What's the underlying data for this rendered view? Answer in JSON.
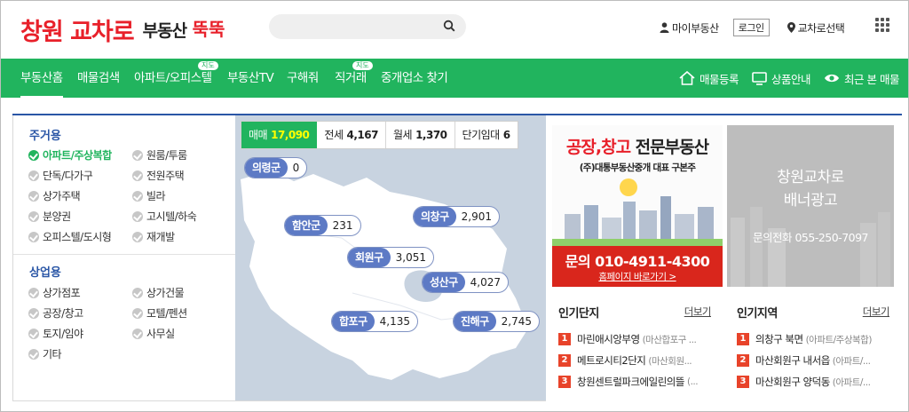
{
  "header": {
    "logo_main": "창원 교차로",
    "logo_sub": "부동산",
    "logo_ttok": "뚝뚝",
    "search_placeholder": "",
    "my_realestate": "마이부동산",
    "login": "로그인",
    "region_select": "교차로선택"
  },
  "nav": {
    "items": [
      {
        "label": "부동산홈",
        "badge": ""
      },
      {
        "label": "매물검색",
        "badge": ""
      },
      {
        "label": "아파트/오피스텔",
        "badge": "지도"
      },
      {
        "label": "부동산TV",
        "badge": ""
      },
      {
        "label": "구해줘",
        "badge": ""
      },
      {
        "label": "직거래",
        "badge": "지도"
      },
      {
        "label": "중개업소 찾기",
        "badge": ""
      }
    ],
    "right": {
      "register": "매물등록",
      "product": "상품안내",
      "recent": "최근 본 매물"
    }
  },
  "categories": {
    "residential_title": "주거용",
    "residential": [
      "아파트/주상복합",
      "원룸/투룸",
      "단독/다가구",
      "전원주택",
      "상가주택",
      "빌라",
      "분양권",
      "고시텔/하숙",
      "오피스텔/도시형",
      "재개발"
    ],
    "commercial_title": "상업용",
    "commercial": [
      "상가점포",
      "상가건물",
      "공장/창고",
      "모텔/펜션",
      "토지/임야",
      "사무실",
      "기타"
    ]
  },
  "map": {
    "tabs": [
      {
        "label": "매매",
        "count": "17,090"
      },
      {
        "label": "전세",
        "count": "4,167"
      },
      {
        "label": "월세",
        "count": "1,370"
      },
      {
        "label": "단기임대",
        "count": "6"
      }
    ],
    "regions": [
      {
        "name": "의령군",
        "count": "0"
      },
      {
        "name": "함안군",
        "count": "231"
      },
      {
        "name": "의창구",
        "count": "2,901"
      },
      {
        "name": "회원구",
        "count": "3,051"
      },
      {
        "name": "성산구",
        "count": "4,027"
      },
      {
        "name": "합포구",
        "count": "4,135"
      },
      {
        "name": "진해구",
        "count": "2,745"
      }
    ]
  },
  "ads": {
    "ad1_title_red": "공장,창고",
    "ad1_title_black": "전문부동산",
    "ad1_company": "(주)대통부동산중개 대표 구본주",
    "ad1_phone": "문의 010-4911-4300",
    "ad1_homepage": "홈페이지 바로가기 >",
    "ad2_line1": "창원교차로",
    "ad2_line2": "배너광고",
    "ad2_phone": "문의전화 055-250-7097"
  },
  "popular_complex": {
    "title": "인기단지",
    "more": "더보기",
    "items": [
      {
        "rank": "1",
        "name": "마린애시앙부영",
        "sub": "(마산합포구 ..."
      },
      {
        "rank": "2",
        "name": "메트로시티2단지",
        "sub": "(마산회원..."
      },
      {
        "rank": "3",
        "name": "창원센트럴파크에일린의뜰",
        "sub": "(..."
      }
    ]
  },
  "popular_region": {
    "title": "인기지역",
    "more": "더보기",
    "items": [
      {
        "rank": "1",
        "name": "의창구 북면",
        "sub": "(아파트/주상복합)"
      },
      {
        "rank": "2",
        "name": "마산회원구 내서읍",
        "sub": "(아파트/..."
      },
      {
        "rank": "3",
        "name": "마산회원구 양덕동",
        "sub": "(아파트/..."
      }
    ]
  },
  "colors": {
    "brand_red": "#e8202a",
    "nav_green": "#21b45e",
    "accent_blue": "#2a56a6",
    "pin_blue": "#5d7ac5"
  }
}
